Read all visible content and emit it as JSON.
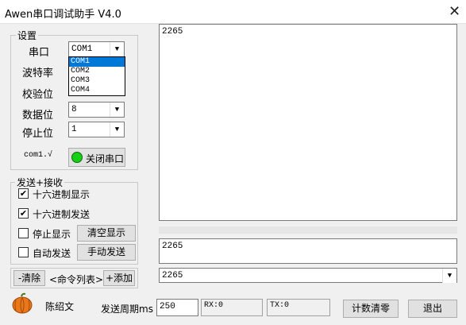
{
  "window": {
    "title": "Awen串口调试助手 V4.0",
    "close_glyph": "✕"
  },
  "settings": {
    "legend": "设置",
    "port_label": "串口",
    "baud_label": "波特率",
    "parity_label": "校验位",
    "databits_label": "数据位",
    "stopbits_label": "停止位",
    "port_value": "COM1",
    "port_options": [
      "COM1",
      "COM2",
      "COM3",
      "COM4"
    ],
    "databits_value": "8",
    "stopbits_value": "1",
    "status_text": "com1.√",
    "toggle_button": "关闭串口"
  },
  "sendrecv": {
    "legend": "发送+接收",
    "hex_display": "十六进制显示",
    "hex_send": "十六进制发送",
    "stop_display": "停止显示",
    "auto_send": "自动发送",
    "clear_display": "清空显示",
    "manual_send": "手动发送"
  },
  "cmd": {
    "remove": "-清除",
    "list": "<命令列表>",
    "add": "+添加",
    "combo_value": "2265"
  },
  "receive_text": "2265",
  "send_text": "2265",
  "footer": {
    "author": "陈绍文",
    "period_label": "发送周期ms",
    "period_value": "250",
    "rx": "RX:0",
    "tx": "TX:0",
    "clear_count": "计数清零",
    "exit": "退出"
  },
  "colors": {
    "led_on": "#14d114",
    "selection": "#0078d7"
  }
}
